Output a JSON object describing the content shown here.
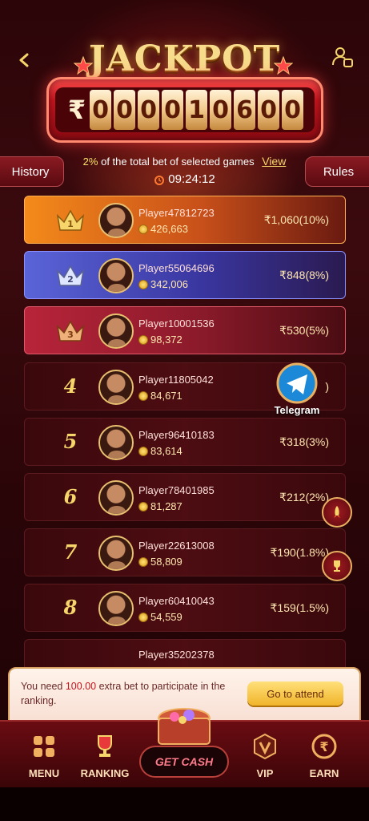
{
  "header": {
    "title": "JACKPOT",
    "back_icon": "chevron-left-icon",
    "profile_icon": "user-settings-icon"
  },
  "jackpot": {
    "currency": "₹",
    "digits": [
      "0",
      "0",
      "0",
      "0",
      "1",
      "0",
      "6",
      "0",
      "0"
    ]
  },
  "info": {
    "percent": "2%",
    "text": "of the total bet of selected games",
    "view": "View",
    "timer": "09:24:12"
  },
  "buttons": {
    "history": "History",
    "rules": "Rules"
  },
  "rankings": [
    {
      "rank": "1",
      "name": "Player47812723",
      "score": "426,663",
      "prize": "₹1,060(10%)"
    },
    {
      "rank": "2",
      "name": "Player55064696",
      "score": "342,006",
      "prize": "₹848(8%)"
    },
    {
      "rank": "3",
      "name": "Player10001536",
      "score": "98,372",
      "prize": "₹530(5%)"
    },
    {
      "rank": "4",
      "name": "Player11805042",
      "score": "84,671",
      "prize": ")"
    },
    {
      "rank": "5",
      "name": "Player96410183",
      "score": "83,614",
      "prize": "₹318(3%)"
    },
    {
      "rank": "6",
      "name": "Player78401985",
      "score": "81,287",
      "prize": "₹212(2%)"
    },
    {
      "rank": "7",
      "name": "Player22613008",
      "score": "58,809",
      "prize": "₹190(1.8%)"
    },
    {
      "rank": "8",
      "name": "Player60410043",
      "score": "54,559",
      "prize": "₹159(1.5%)"
    },
    {
      "rank": "",
      "name": "Player35202378",
      "score": "",
      "prize": ""
    }
  ],
  "telegram": {
    "label": "Telegram"
  },
  "notice": {
    "prefix": "You need ",
    "amount": "100.00",
    "suffix": " extra bet to participate in the ranking.",
    "button": "Go to attend"
  },
  "nav": {
    "menu": "MENU",
    "ranking": "RANKING",
    "get_cash": "GET CASH",
    "vip": "VIP",
    "earn": "EARN"
  },
  "colors": {
    "accent": "#f6d56a",
    "primary": "#c8141e",
    "background": "#2b0508"
  }
}
